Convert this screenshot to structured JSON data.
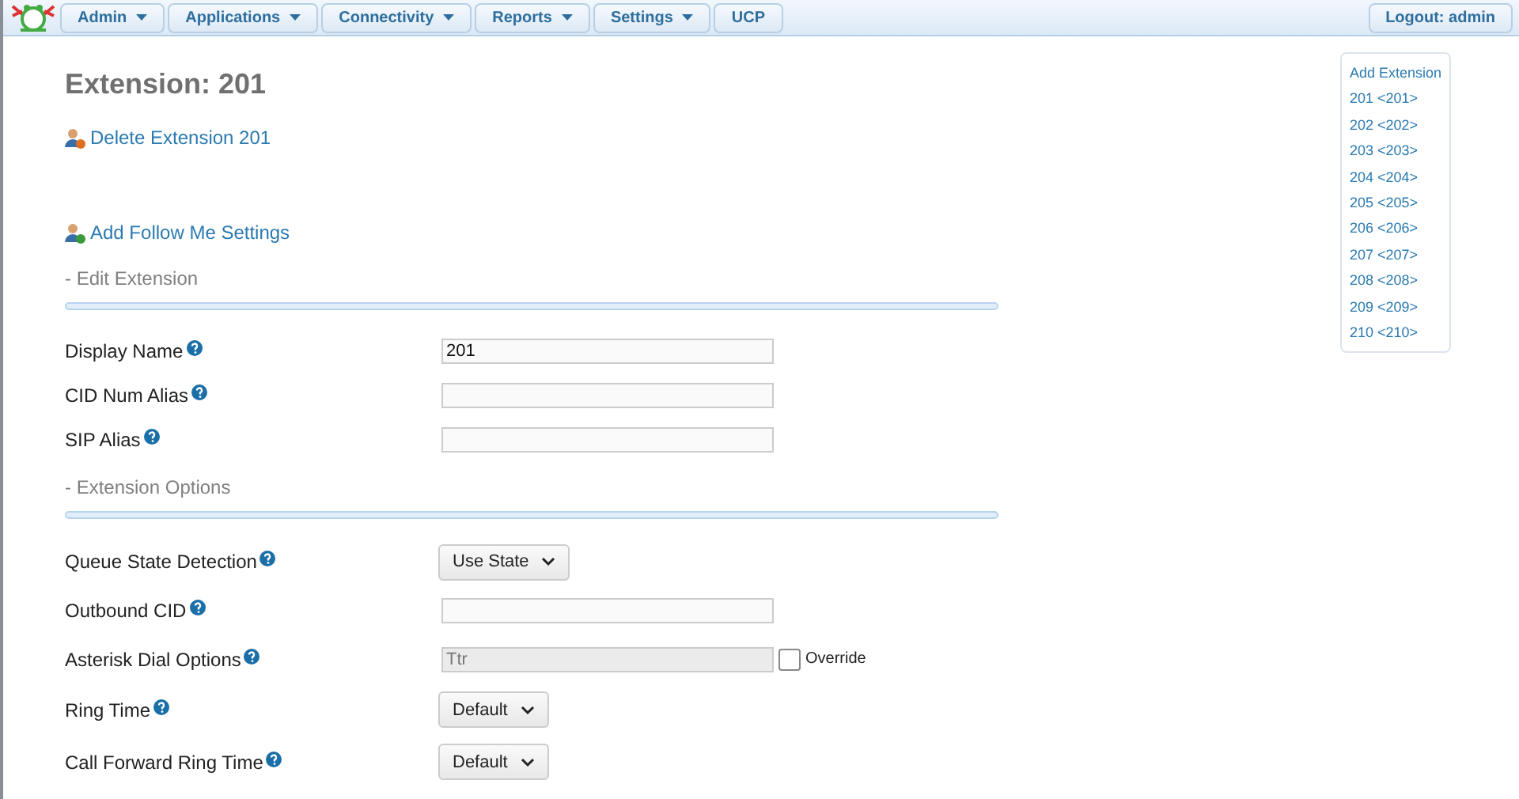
{
  "nav": {
    "menus": [
      {
        "label": "Admin",
        "dropdown": true
      },
      {
        "label": "Applications",
        "dropdown": true
      },
      {
        "label": "Connectivity",
        "dropdown": true
      },
      {
        "label": "Reports",
        "dropdown": true
      },
      {
        "label": "Settings",
        "dropdown": true
      },
      {
        "label": "UCP",
        "dropdown": false
      }
    ],
    "logout": "Logout: admin"
  },
  "title": "Extension: 201",
  "actions": [
    {
      "label": "Delete Extension 201",
      "kind": "delete"
    },
    {
      "label": "Add Follow Me Settings",
      "kind": "add"
    }
  ],
  "sections": [
    {
      "title": "- Edit Extension",
      "fields": [
        {
          "label": "Display Name",
          "kind": "input",
          "value": "201",
          "disabled": false
        },
        {
          "label": "CID Num Alias",
          "kind": "input",
          "disabled": false
        },
        {
          "label": "SIP Alias",
          "kind": "input",
          "disabled": false
        }
      ]
    },
    {
      "title": "- Extension Options",
      "fields": [
        {
          "label": "Queue State Detection",
          "kind": "select",
          "value": "Use State"
        },
        {
          "label": "Outbound CID",
          "kind": "input",
          "disabled": false
        },
        {
          "label": "Asterisk Dial Options",
          "kind": "input",
          "value": "Ttr",
          "disabled": true,
          "checkbox": {
            "label": "Override",
            "checked": false
          }
        },
        {
          "label": "Ring Time",
          "kind": "select",
          "value": "Default"
        },
        {
          "label": "Call Forward Ring Time",
          "kind": "select",
          "value": "Default"
        }
      ]
    }
  ],
  "sidebar": {
    "items": [
      "Add Extension",
      "201 <201>",
      "202 <202>",
      "203 <203>",
      "204 <204>",
      "205 <205>",
      "206 <206>",
      "207 <207>",
      "208 <208>",
      "209 <209>",
      "210 <210>"
    ]
  }
}
